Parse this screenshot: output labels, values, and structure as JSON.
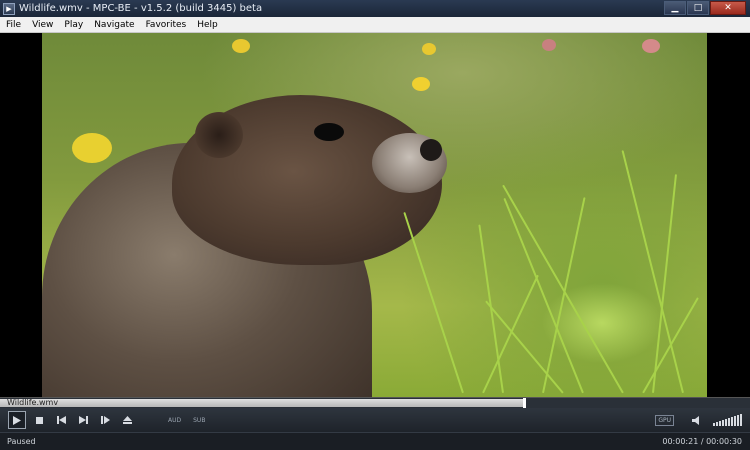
{
  "window": {
    "title": "Wildlife.wmv - MPC-BE - v1.5.2 (build 3445) beta",
    "buttons": {
      "minimize": "▁",
      "maximize": "□",
      "close": "✕"
    }
  },
  "menu": [
    "File",
    "View",
    "Play",
    "Navigate",
    "Favorites",
    "Help"
  ],
  "video": {
    "content": "marmot-in-grass"
  },
  "seek": {
    "filename": "Wildlife.wmv",
    "progress": 0.7
  },
  "controls": {
    "icons": [
      "play-icon",
      "stop-icon",
      "prev-icon",
      "next-icon",
      "frame-step-icon",
      "eject-icon"
    ],
    "audio_label": "AUD",
    "subtitle_label": "SUB",
    "gpu_label": "GPU",
    "volume_level": 1.0
  },
  "status": {
    "state": "Paused",
    "time": "00:00:21 / 00:00:30"
  }
}
